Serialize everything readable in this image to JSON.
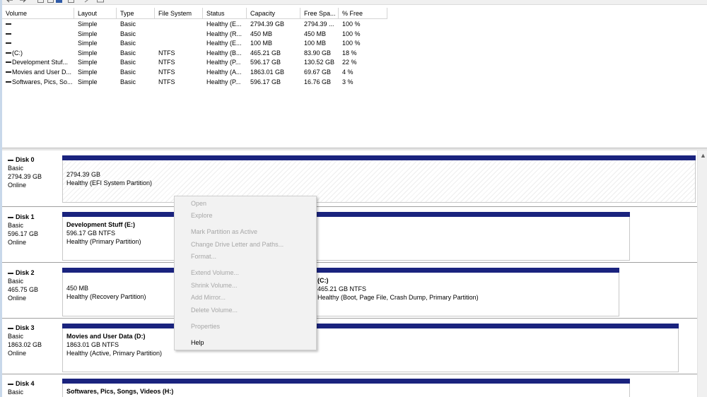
{
  "volume_list": {
    "columns": [
      "Volume",
      "Layout",
      "Type",
      "File System",
      "Status",
      "Capacity",
      "Free Spa...",
      "% Free"
    ],
    "rows": [
      {
        "volume": "",
        "layout": "Simple",
        "type": "Basic",
        "fs": "",
        "status": "Healthy (E...",
        "capacity": "2794.39 GB",
        "free": "2794.39 ...",
        "pct": "100 %"
      },
      {
        "volume": "",
        "layout": "Simple",
        "type": "Basic",
        "fs": "",
        "status": "Healthy (R...",
        "capacity": "450 MB",
        "free": "450 MB",
        "pct": "100 %"
      },
      {
        "volume": "",
        "layout": "Simple",
        "type": "Basic",
        "fs": "",
        "status": "Healthy (E...",
        "capacity": "100 MB",
        "free": "100 MB",
        "pct": "100 %"
      },
      {
        "volume": "(C:)",
        "layout": "Simple",
        "type": "Basic",
        "fs": "NTFS",
        "status": "Healthy (B...",
        "capacity": "465.21 GB",
        "free": "83.90 GB",
        "pct": "18 %"
      },
      {
        "volume": "Development Stuf...",
        "layout": "Simple",
        "type": "Basic",
        "fs": "NTFS",
        "status": "Healthy (P...",
        "capacity": "596.17 GB",
        "free": "130.52 GB",
        "pct": "22 %"
      },
      {
        "volume": "Movies and User D...",
        "layout": "Simple",
        "type": "Basic",
        "fs": "NTFS",
        "status": "Healthy (A...",
        "capacity": "1863.01 GB",
        "free": "69.67 GB",
        "pct": "4 %"
      },
      {
        "volume": "Softwares, Pics, So...",
        "layout": "Simple",
        "type": "Basic",
        "fs": "NTFS",
        "status": "Healthy (P...",
        "capacity": "596.17 GB",
        "free": "16.76 GB",
        "pct": "3 %"
      }
    ]
  },
  "disks": [
    {
      "name": "Disk 0",
      "type": "Basic",
      "size": "2794.39 GB",
      "state": "Online",
      "partitions": [
        {
          "title": "",
          "size": "2794.39 GB",
          "status": "Healthy (EFI System Partition)"
        }
      ]
    },
    {
      "name": "Disk 1",
      "type": "Basic",
      "size": "596.17 GB",
      "state": "Online",
      "partitions": [
        {
          "title": "Development Stuff  (E:)",
          "size": "596.17 GB NTFS",
          "status": "Healthy (Primary Partition)"
        }
      ]
    },
    {
      "name": "Disk 2",
      "type": "Basic",
      "size": "465.75 GB",
      "state": "Online",
      "partitions": [
        {
          "title": "",
          "size": "450 MB",
          "status": "Healthy (Recovery Partition)"
        },
        {
          "title": "(C:)",
          "size": "465.21 GB NTFS",
          "status": "Healthy (Boot, Page File, Crash Dump, Primary Partition)"
        }
      ]
    },
    {
      "name": "Disk 3",
      "type": "Basic",
      "size": "1863.02 GB",
      "state": "Online",
      "partitions": [
        {
          "title": "Movies and User Data  (D:)",
          "size": "1863.01 GB NTFS",
          "status": "Healthy (Active, Primary Partition)"
        }
      ]
    },
    {
      "name": "Disk 4",
      "type": "Basic",
      "size": "",
      "state": "",
      "partitions": [
        {
          "title": "Softwares, Pics, Songs, Videos  (H:)",
          "size": "",
          "status": ""
        }
      ]
    }
  ],
  "context_menu": {
    "items": [
      {
        "label": "Open",
        "enabled": false
      },
      {
        "label": "Explore",
        "enabled": false
      },
      {
        "label": "Mark Partition as Active",
        "enabled": false
      },
      {
        "label": "Change Drive Letter and Paths...",
        "enabled": false
      },
      {
        "label": "Format...",
        "enabled": false
      },
      {
        "label": "Extend Volume...",
        "enabled": false
      },
      {
        "label": "Shrink Volume...",
        "enabled": false
      },
      {
        "label": "Add Mirror...",
        "enabled": false
      },
      {
        "label": "Delete Volume...",
        "enabled": false
      },
      {
        "label": "Properties",
        "enabled": false
      },
      {
        "label": "Help",
        "enabled": true
      }
    ]
  },
  "colors": {
    "partition_bar": "#1a237e",
    "disabled_text": "#a7a7a7"
  }
}
